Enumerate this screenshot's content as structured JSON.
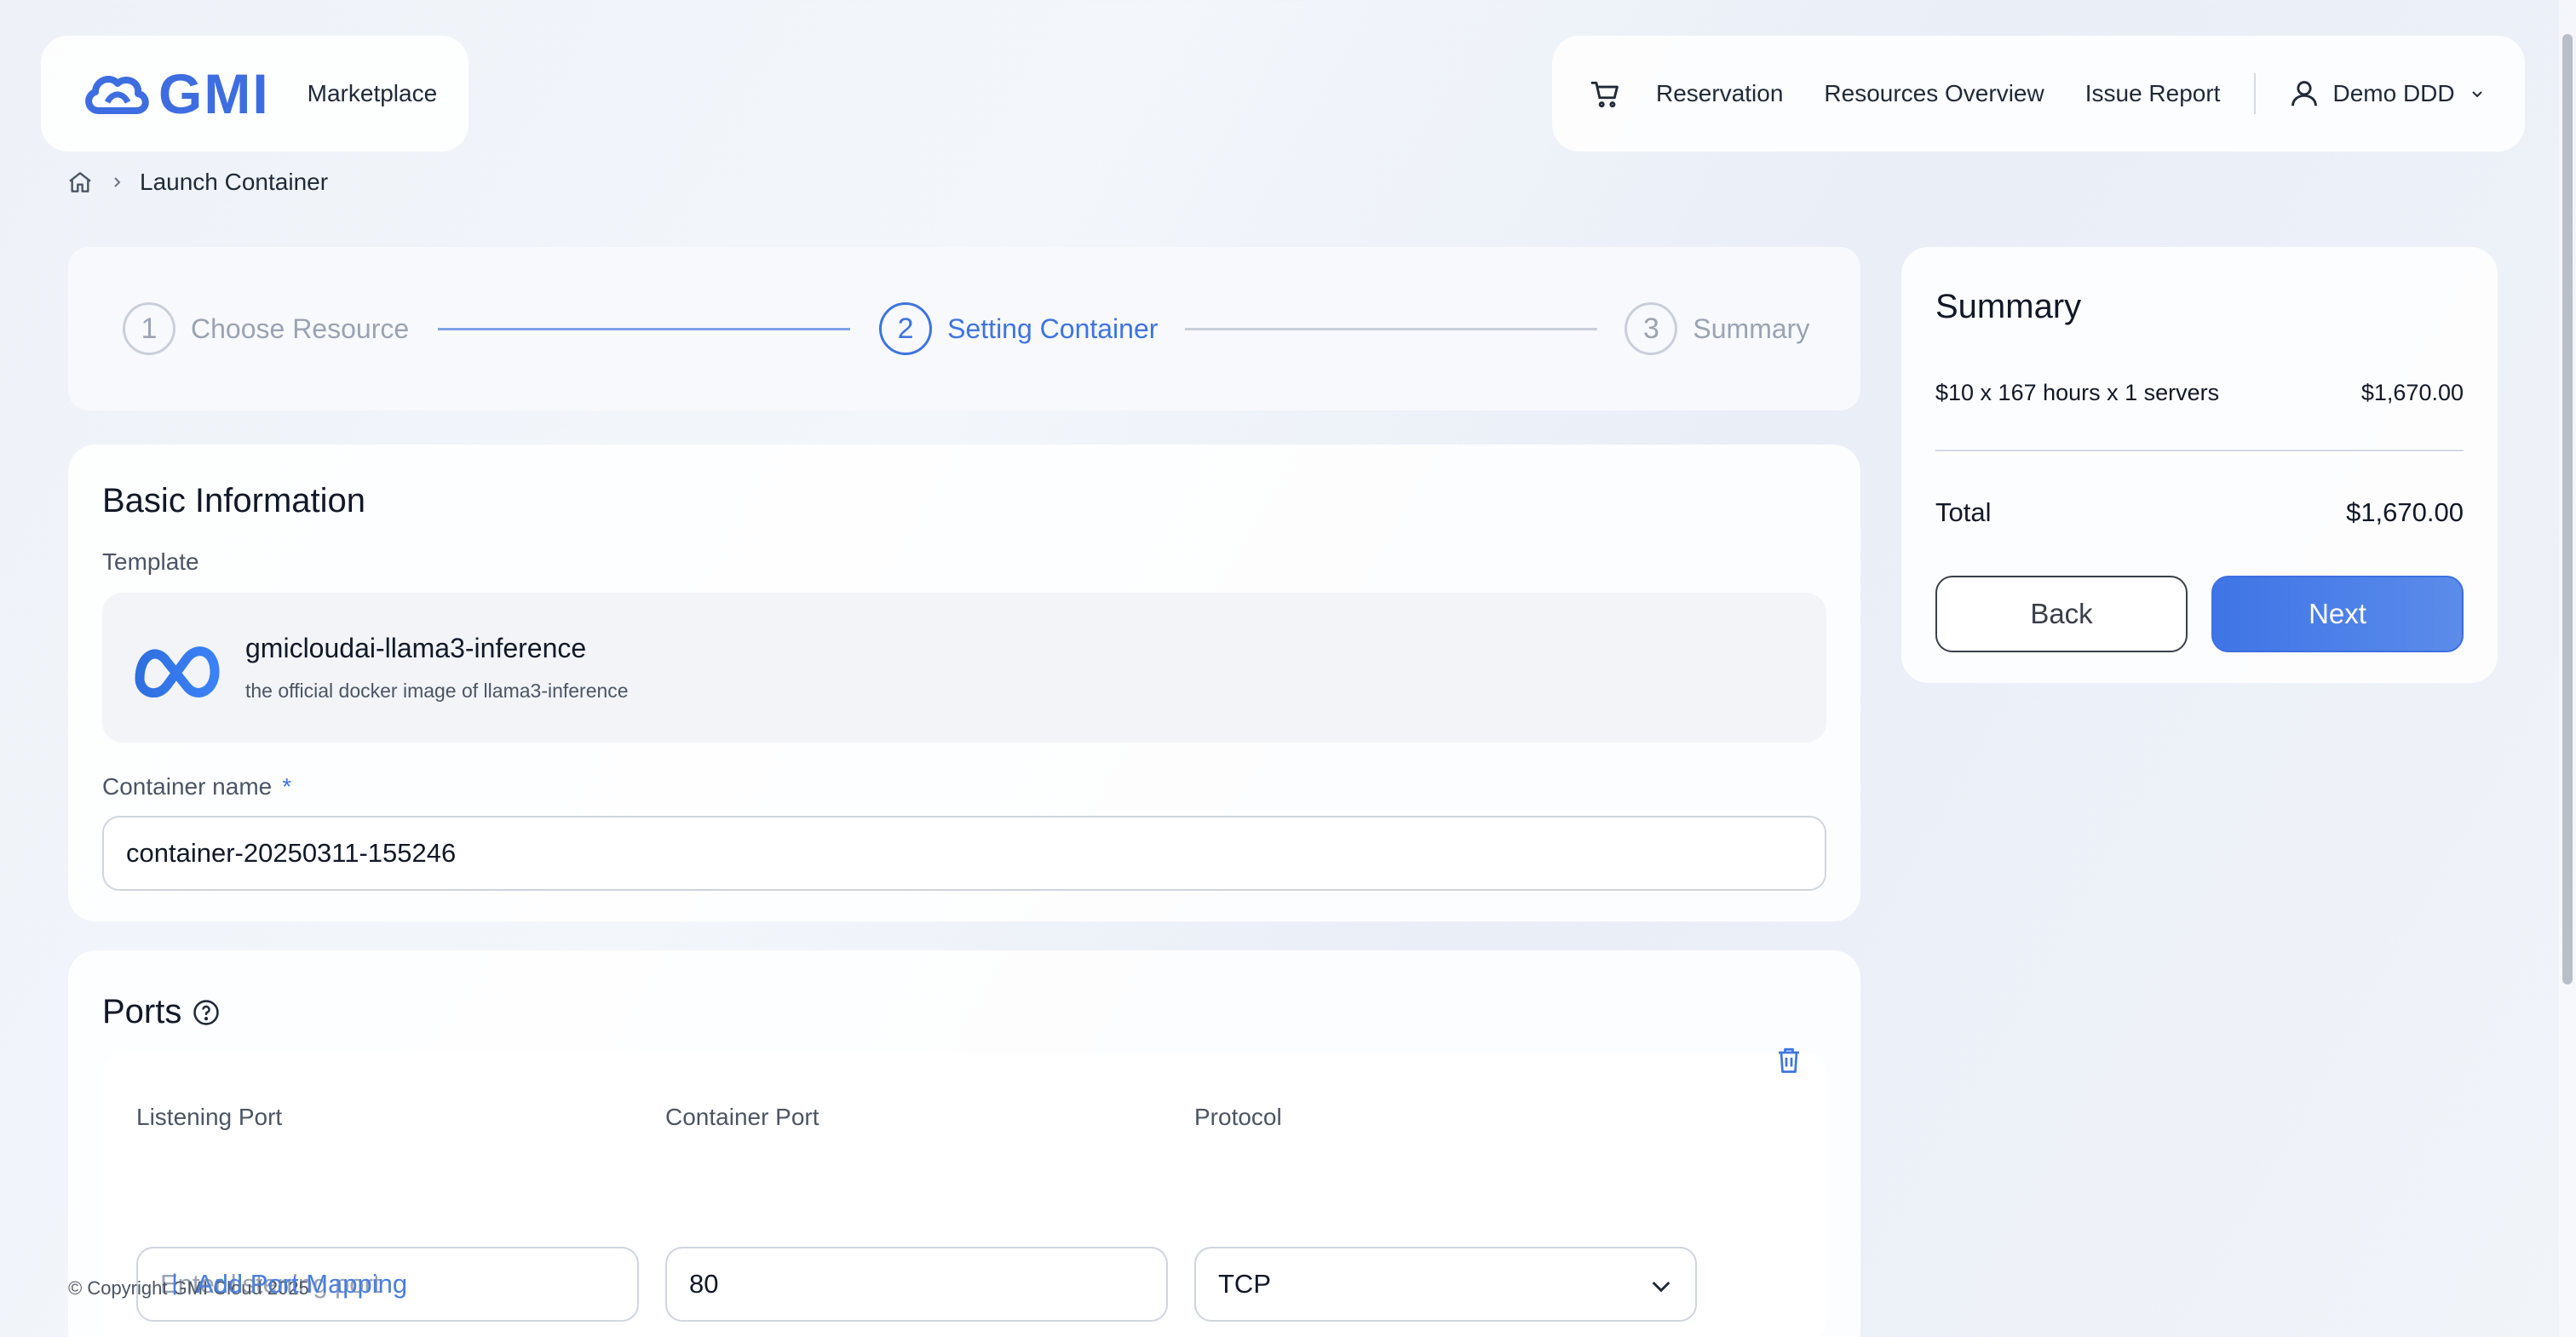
{
  "header": {
    "brand": "GMI",
    "marketplace": "Marketplace",
    "nav": [
      "Reservation",
      "Resources Overview",
      "Issue Report"
    ],
    "user": "Demo DDD"
  },
  "breadcrumb": {
    "current": "Launch Container"
  },
  "stepper": {
    "steps": [
      {
        "number": "1",
        "label": "Choose Resource"
      },
      {
        "number": "2",
        "label": "Setting Container"
      },
      {
        "number": "3",
        "label": "Summary"
      }
    ],
    "active_step": 2
  },
  "basic": {
    "title": "Basic Information",
    "template_label": "Template",
    "template_name": "gmicloudai-llama3-inference",
    "template_desc": "the official docker image of llama3-inference",
    "container_name_label": "Container name",
    "required_mark": "*",
    "container_name_value": "container-20250311-155246"
  },
  "ports": {
    "title": "Ports",
    "listening_label": "Listening Port",
    "container_label": "Container Port",
    "protocol_label": "Protocol",
    "listening_placeholder": "Enter listening port",
    "container_value": "80",
    "protocol_value": "TCP",
    "add_label": "Add Port Mapping"
  },
  "footer": {
    "copyright": "© Copyright GMI Cloud 2025"
  },
  "summary": {
    "title": "Summary",
    "line_desc": "$10 x 167 hours x 1 servers",
    "line_amount": "$1,670.00",
    "total_label": "Total",
    "total_amount": "$1,670.00",
    "back_label": "Back",
    "next_label": "Next"
  },
  "colors": {
    "accent": "#3f74e0",
    "brand": "#3d6de0"
  },
  "icons": [
    "cloud-logo-icon",
    "cart-icon",
    "user-icon",
    "chevron-down-icon",
    "home-icon",
    "chevron-right-icon",
    "meta-logo-icon",
    "help-icon",
    "trash-icon",
    "plus-icon"
  ]
}
